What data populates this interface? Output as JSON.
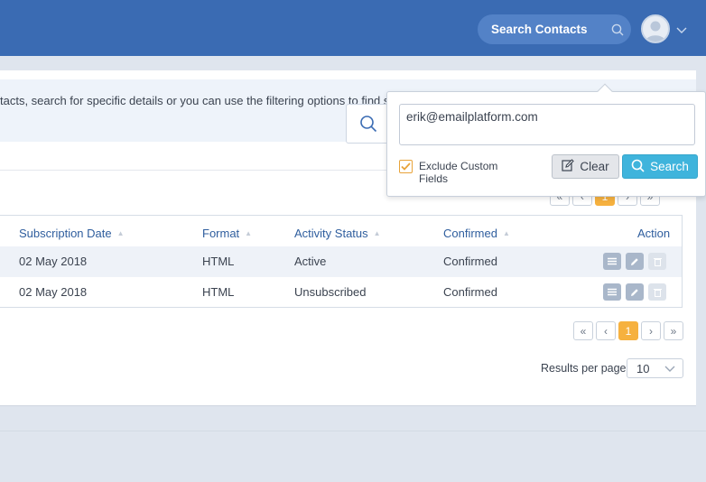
{
  "header": {
    "search_label": "Search Contacts",
    "search_icon": "search-icon",
    "avatar_icon": "user-avatar-icon"
  },
  "banner": {
    "text": "tacts, search for specific details or you can use the filtering options to find specific contacts.",
    "close": "✕"
  },
  "pagination_top": {
    "first": "«",
    "prev": "‹",
    "current": "1",
    "next": "›",
    "last": "»"
  },
  "table": {
    "columns": [
      "Subscription Date",
      "Format",
      "Activity Status",
      "Confirmed",
      "Action"
    ],
    "rows": [
      {
        "date": "02 May 2018",
        "format": "HTML",
        "status": "Active",
        "confirmed": "Confirmed"
      },
      {
        "date": "02 May 2018",
        "format": "HTML",
        "status": "Unsubscribed",
        "confirmed": "Confirmed"
      }
    ]
  },
  "pagination_bottom": {
    "first": "«",
    "prev": "‹",
    "current": "1",
    "next": "›",
    "last": "»"
  },
  "results_per_page": {
    "label": "Results per page",
    "value": "10"
  },
  "popover": {
    "query": "erik@emailplatform.com",
    "exclude_label": "Exclude Custom Fields",
    "exclude_checked": true,
    "clear_label": "Clear",
    "search_label": "Search"
  },
  "colors": {
    "topbar": "#3a6bb3",
    "accent_orange": "#f6b13f",
    "search_button": "#3fb4dc",
    "header_link": "#2f5e9e"
  }
}
